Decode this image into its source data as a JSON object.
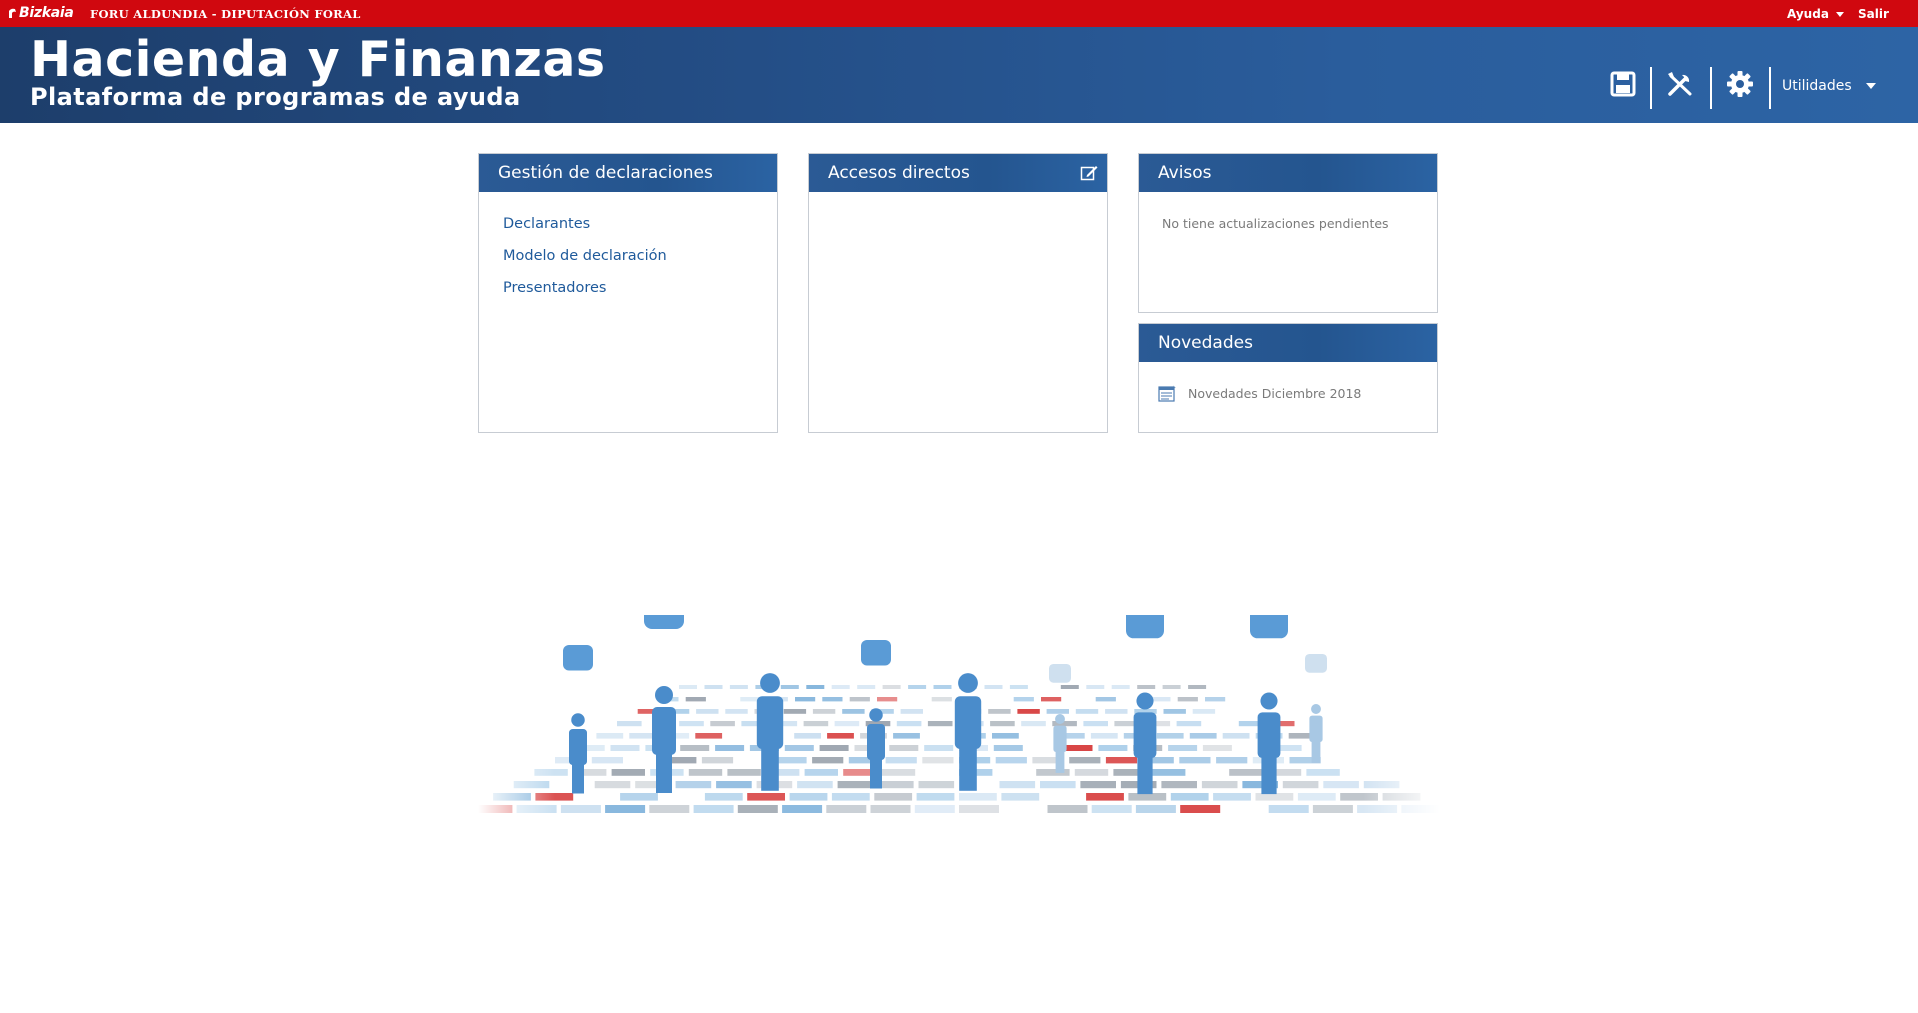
{
  "topbar": {
    "logo": "Bizkaia",
    "org": "FORU ALDUNDIA - DIPUTACIÓN FORAL",
    "help": "Ayuda",
    "exit": "Salir"
  },
  "header": {
    "title": "Hacienda y Finanzas",
    "subtitle": "Plataforma de programas de ayuda",
    "icons": [
      "save-icon",
      "tools-icon",
      "gear-icon"
    ],
    "utilities": "Utilidades"
  },
  "panels": {
    "gestion": {
      "title": "Gestión de declaraciones",
      "links": [
        "Declarantes",
        "Modelo de declaración",
        "Presentadores"
      ]
    },
    "accesos": {
      "title": "Accesos directos"
    },
    "avisos": {
      "title": "Avisos",
      "text": "No tiene actualizaciones pendientes"
    },
    "novedades": {
      "title": "Novedades",
      "items": [
        "Novedades Diciembre 2018"
      ]
    }
  },
  "colors": {
    "topbar": "#d0080f",
    "header": "#234c83",
    "panel_head": "#24558f",
    "link": "#1f5a9b"
  }
}
